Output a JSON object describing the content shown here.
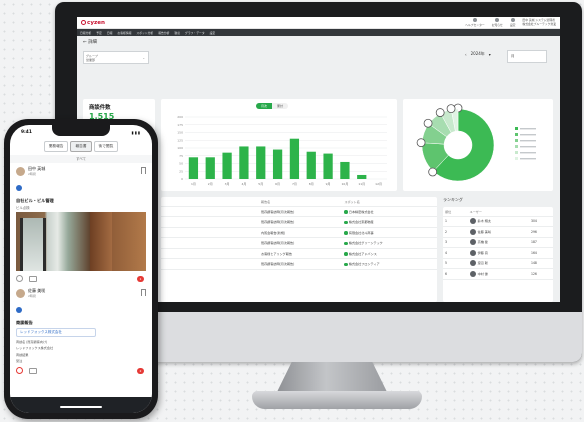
{
  "desktop": {
    "logo": "cyzen",
    "top_icons": [
      {
        "label": "ヘルプセンター",
        "icon": "help-icon"
      },
      {
        "label": "お知らせ",
        "icon": "bell-icon"
      },
      {
        "label": "設定",
        "icon": "gear-icon"
      }
    ],
    "user": {
      "name": "田中 英城 システム管理者",
      "company": "株式会社ブルーテック営業"
    },
    "nav_items": [
      "日報分析",
      "予定",
      "日報",
      "お客様情報",
      "スポット分析",
      "報告分析",
      "勤怠",
      "グラフ・データ",
      "設定"
    ],
    "breadcrumb": "← 詳細",
    "filter": {
      "label": "グループ",
      "value": "営業部"
    },
    "year": "2024年",
    "month": "月",
    "kpi": {
      "title": "商談件数",
      "value": "1,515"
    },
    "chart_toggle": [
      "月次",
      "累計"
    ],
    "ranking_title": "ランキング",
    "deals_table": {
      "columns": [
        "報告名",
        "スポット名"
      ],
      "rows": [
        [
          "既存顧客訪問(月次報告)",
          "日本精密株式会社"
        ],
        [
          "既存顧客訪問(月次報告)",
          "株式会社東都物産"
        ],
        [
          "内覧会報告(新規)",
          "有限会社北斗商事"
        ],
        [
          "既存顧客訪問(月次報告)",
          "株式会社グリーンテック"
        ],
        [
          "お客様ヒアリング報告",
          "株式会社アドバンス"
        ],
        [
          "既存顧客訪問(月次報告)",
          "株式会社フロンティア"
        ]
      ]
    },
    "ranking_table": {
      "columns": [
        "順位",
        "ユーザー"
      ],
      "rows": [
        [
          "1",
          "鈴木 翔太",
          "304"
        ],
        [
          "2",
          "佐藤 美咲",
          "296"
        ],
        [
          "3",
          "高橋 健",
          "187"
        ],
        [
          "4",
          "伊藤 真",
          "164"
        ],
        [
          "5",
          "渡辺 聡",
          "148"
        ],
        [
          "6",
          "中村 優",
          "126"
        ]
      ]
    }
  },
  "chart_data": [
    {
      "type": "bar",
      "categories": [
        "1月",
        "2月",
        "3月",
        "4月",
        "5月",
        "6月",
        "7月",
        "8月",
        "9月",
        "10月",
        "11月",
        "12月"
      ],
      "values": [
        70,
        70,
        85,
        105,
        105,
        95,
        130,
        88,
        82,
        55,
        13,
        0
      ],
      "ylim": [
        0,
        200
      ],
      "color": "#2db34a"
    },
    {
      "type": "pie",
      "variant": "donut",
      "values": [
        62,
        14,
        9,
        7,
        5,
        3
      ],
      "colors": [
        "#3cba54",
        "#5ec46e",
        "#83d08f",
        "#a7ddb0",
        "#c8e9cd",
        "#e0f3e3"
      ],
      "legend_placement": "right"
    }
  ],
  "phone": {
    "time": "9:41",
    "tabs": [
      "業務報告",
      "報告書",
      "後で閲覧"
    ],
    "filter": "すべて",
    "posts": [
      {
        "author": "田中 英城",
        "time": "2時間",
        "title": "自社ビル・ビル管理",
        "subtitle": "ビル点検",
        "likes": "1"
      },
      {
        "author": "佐藤 美咲",
        "time": "2時間",
        "title": "商談報告",
        "company": "レッドフォックス株式会社",
        "line1": "商談名 (既存顧客向け)",
        "line2": "レッドフォックス株式会社",
        "line3": "商談結果",
        "line4": "受注",
        "likes": "2"
      }
    ]
  }
}
